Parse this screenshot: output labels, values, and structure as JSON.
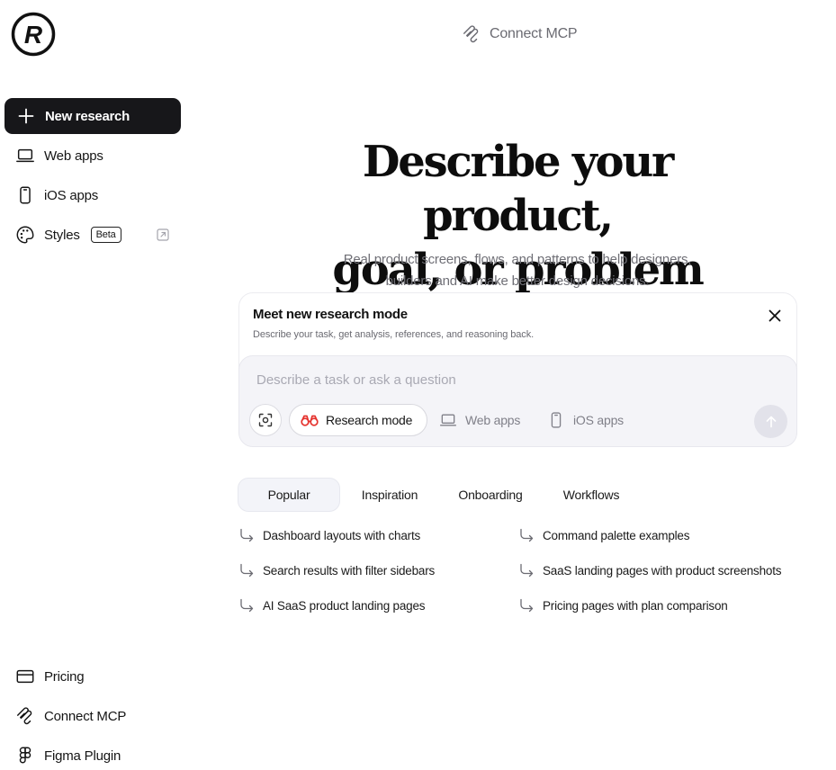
{
  "brand": {
    "logo_letter": "R"
  },
  "sidebar": {
    "new_research_label": "New research",
    "items": [
      {
        "label": "Web apps",
        "icon": "laptop-icon"
      },
      {
        "label": "iOS apps",
        "icon": "phone-icon"
      },
      {
        "label": "Styles",
        "icon": "palette-icon",
        "badge": "Beta"
      }
    ],
    "bottom_items": [
      {
        "label": "Pricing",
        "icon": "credit-card-icon"
      },
      {
        "label": "Connect MCP",
        "icon": "mcp-icon"
      },
      {
        "label": "Figma Plugin",
        "icon": "figma-icon"
      }
    ]
  },
  "header": {
    "connect_mcp_label": "Connect MCP"
  },
  "hero": {
    "title_line1": "Describe your product,",
    "title_line2": "goal, or problem",
    "subtitle_line1": "Real product screens, flows, and patterns to help designers,",
    "subtitle_line2": "builders and AI make better design decisions."
  },
  "research_card": {
    "title": "Meet new research mode",
    "description": "Describe your task, get analysis, references, and reasoning back.",
    "input_placeholder": "Describe a task or ask a question",
    "input_value": "",
    "mode_button_label": "Research mode",
    "chips": [
      {
        "label": "Web apps",
        "icon": "laptop-icon"
      },
      {
        "label": "iOS apps",
        "icon": "phone-icon"
      }
    ]
  },
  "tabs": [
    {
      "label": "Popular",
      "active": true
    },
    {
      "label": "Inspiration",
      "active": false
    },
    {
      "label": "Onboarding",
      "active": false
    },
    {
      "label": "Workflows",
      "active": false
    }
  ],
  "suggestions": [
    "Dashboard layouts with charts",
    "Search results with filter sidebars",
    "AI SaaS product landing pages",
    "Command palette examples",
    "SaaS landing pages with product screenshots",
    "Pricing pages with plan comparison"
  ],
  "colors": {
    "primary_dark": "#17171a",
    "muted_text": "#6b6b72",
    "input_bg": "#f4f4f8",
    "accent_red": "#e5322d"
  }
}
